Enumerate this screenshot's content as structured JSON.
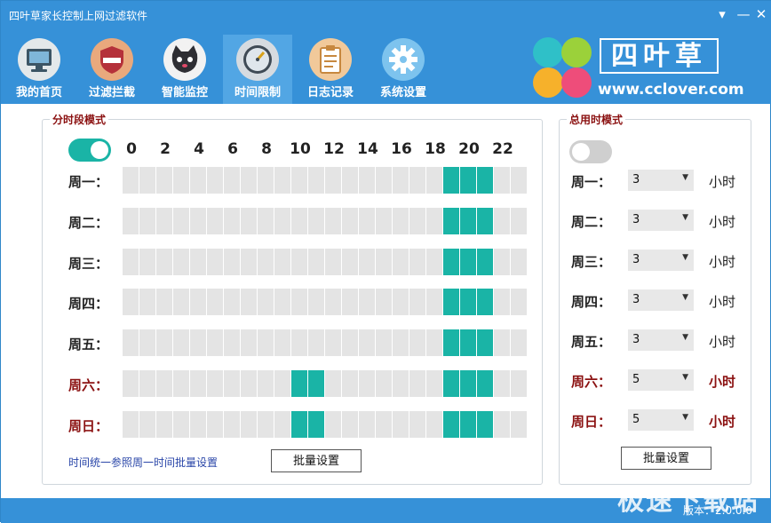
{
  "window": {
    "title": "四叶草家长控制上网过滤软件"
  },
  "nav": [
    {
      "label": "我的首页",
      "icon": "monitor-icon"
    },
    {
      "label": "过滤拦截",
      "icon": "shield-icon"
    },
    {
      "label": "智能监控",
      "icon": "cat-face-icon"
    },
    {
      "label": "时间限制",
      "icon": "clock-icon",
      "active": true
    },
    {
      "label": "日志记录",
      "icon": "clipboard-icon"
    },
    {
      "label": "系统设置",
      "icon": "gear-icon"
    }
  ],
  "logo": {
    "text": "四叶草",
    "url": "www.cclover.com"
  },
  "segment_mode": {
    "title": "分时段模式",
    "toggle_on": true,
    "hours": [
      "0",
      "2",
      "4",
      "6",
      "8",
      "10",
      "12",
      "14",
      "16",
      "18",
      "20",
      "22"
    ],
    "days": [
      {
        "label": "周一：",
        "weekend": false,
        "selected_hours": [
          19,
          20,
          21
        ]
      },
      {
        "label": "周二：",
        "weekend": false,
        "selected_hours": [
          19,
          20,
          21
        ]
      },
      {
        "label": "周三：",
        "weekend": false,
        "selected_hours": [
          19,
          20,
          21
        ]
      },
      {
        "label": "周四：",
        "weekend": false,
        "selected_hours": [
          19,
          20,
          21
        ]
      },
      {
        "label": "周五：",
        "weekend": false,
        "selected_hours": [
          19,
          20,
          21
        ]
      },
      {
        "label": "周六：",
        "weekend": true,
        "selected_hours": [
          10,
          11,
          19,
          20,
          21
        ]
      },
      {
        "label": "周日：",
        "weekend": true,
        "selected_hours": [
          10,
          11,
          19,
          20,
          21
        ]
      }
    ],
    "note": "时间统一参照周一时间批量设置",
    "batch_button": "批量设置"
  },
  "total_mode": {
    "title": "总用时模式",
    "toggle_on": false,
    "unit": "小时",
    "days": [
      {
        "label": "周一：",
        "value": "3",
        "weekend": false
      },
      {
        "label": "周二：",
        "value": "3",
        "weekend": false
      },
      {
        "label": "周三：",
        "value": "3",
        "weekend": false
      },
      {
        "label": "周四：",
        "value": "3",
        "weekend": false
      },
      {
        "label": "周五：",
        "value": "3",
        "weekend": false
      },
      {
        "label": "周六：",
        "value": "5",
        "weekend": true
      },
      {
        "label": "周日：",
        "value": "5",
        "weekend": true
      }
    ],
    "batch_button": "批量设置"
  },
  "status": {
    "version": "版本：2.0.0.0"
  },
  "watermark": "极速下载站",
  "colors": {
    "header": "#3691d8",
    "accent": "#1ab4a6",
    "weekend": "#8b1111",
    "cell_empty": "#e4e4e4"
  }
}
